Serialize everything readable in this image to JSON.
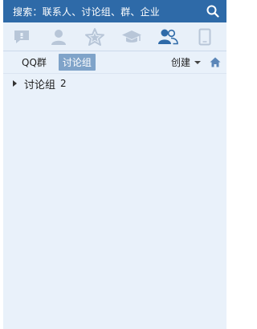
{
  "search": {
    "placeholder": "搜索：联系人、讨论组、群、企业",
    "icon": "search-icon"
  },
  "tabs": [
    {
      "name": "tab-messages",
      "icon": "chat-bubble-icon"
    },
    {
      "name": "tab-contacts",
      "icon": "person-icon"
    },
    {
      "name": "tab-favorites",
      "icon": "star-icon"
    },
    {
      "name": "tab-school",
      "icon": "graduation-cap-icon"
    },
    {
      "name": "tab-groups",
      "icon": "group-icon",
      "active": true
    },
    {
      "name": "tab-devices",
      "icon": "phone-icon"
    }
  ],
  "subnav": {
    "qq_group": "QQ群",
    "discussion": "讨论组",
    "create": "创建"
  },
  "list": [
    {
      "label": "讨论组",
      "count": "2"
    }
  ],
  "colors": {
    "header": "#2e6aa8",
    "panel": "#e9f1fa",
    "active_tab": "#2e6aa8",
    "inactive_icon": "#b8c6d8",
    "segment_active": "#7fa3c9"
  }
}
